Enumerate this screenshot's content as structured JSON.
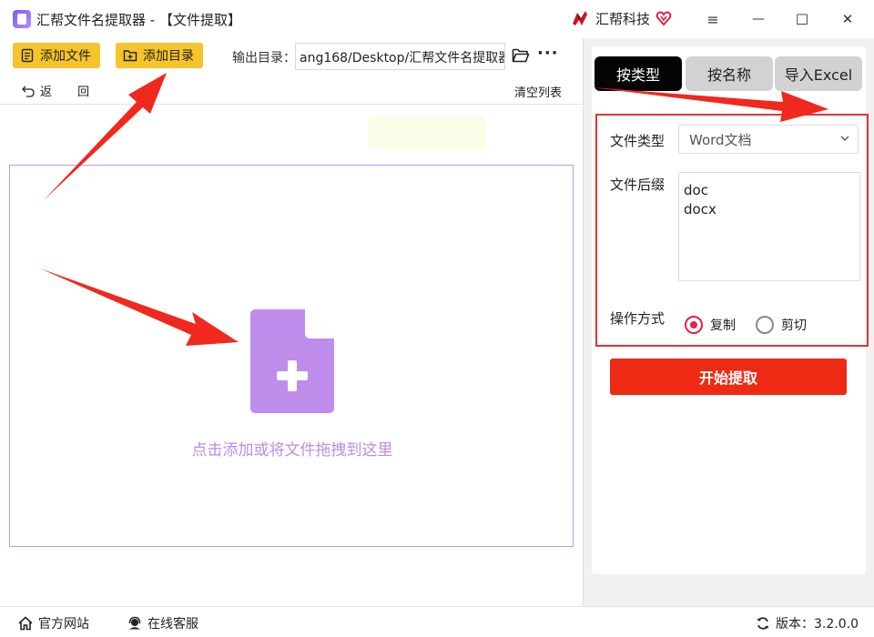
{
  "window": {
    "title": "汇帮文件名提取器 - 【文件提取】",
    "brand": "汇帮科技",
    "controls": {
      "menu": "≡",
      "minimize": "—",
      "maximize": "☐",
      "close": "✕"
    }
  },
  "toolbar": {
    "add_file": "添加文件",
    "add_folder": "添加目录",
    "output_label": "输出目录：",
    "output_path": "ang168/Desktop/汇帮文件名提取器",
    "more": "···",
    "back": "返 回",
    "clear_list": "清空列表"
  },
  "dropzone": {
    "hint": "点击添加或将文件拖拽到这里"
  },
  "right_panel": {
    "tabs": [
      {
        "label": "按类型",
        "active": true
      },
      {
        "label": "按名称",
        "active": false
      },
      {
        "label": "导入Excel",
        "active": false
      }
    ],
    "file_type_label": "文件类型",
    "file_type_value": "Word文档",
    "suffix_label": "文件后缀",
    "suffixes": [
      "doc",
      "docx"
    ],
    "operation_label": "操作方式",
    "operations": [
      {
        "label": "复制",
        "selected": true
      },
      {
        "label": "剪切",
        "selected": false
      }
    ],
    "start_button": "开始提取"
  },
  "footer": {
    "website": "官方网站",
    "support": "在线客服",
    "version": "版本：3.2.0.0"
  },
  "colors": {
    "accent_yellow": "#f6c42a",
    "start_red": "#ee2a14",
    "dropzone_purple": "#b88ee3",
    "annotation_red": "#f0281e"
  }
}
